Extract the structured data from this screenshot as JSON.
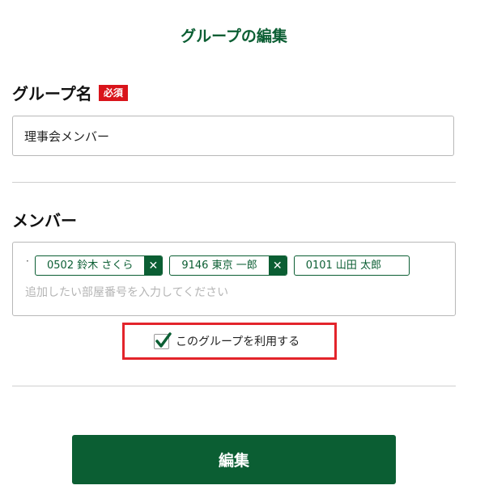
{
  "page": {
    "title": "グループの編集"
  },
  "group_name": {
    "label": "グループ名",
    "required_badge": "必須",
    "value": "理事会メンバー"
  },
  "members": {
    "label": "メンバー",
    "leading_mark": "·",
    "chips": [
      {
        "label": "0502 鈴木 さくら",
        "removable": true
      },
      {
        "label": "9146 東京 一郎",
        "removable": true
      },
      {
        "label": "0101 山田 太郎",
        "removable": false
      }
    ],
    "remove_glyph": "✕",
    "input_placeholder": "追加したい部屋番号を入力してください"
  },
  "use_group": {
    "label": "このグループを利用する",
    "checked": true
  },
  "submit": {
    "label": "編集"
  },
  "colors": {
    "brand_green": "#0b5e33",
    "required_red": "#d9141b",
    "highlight_red": "#e3242b"
  }
}
